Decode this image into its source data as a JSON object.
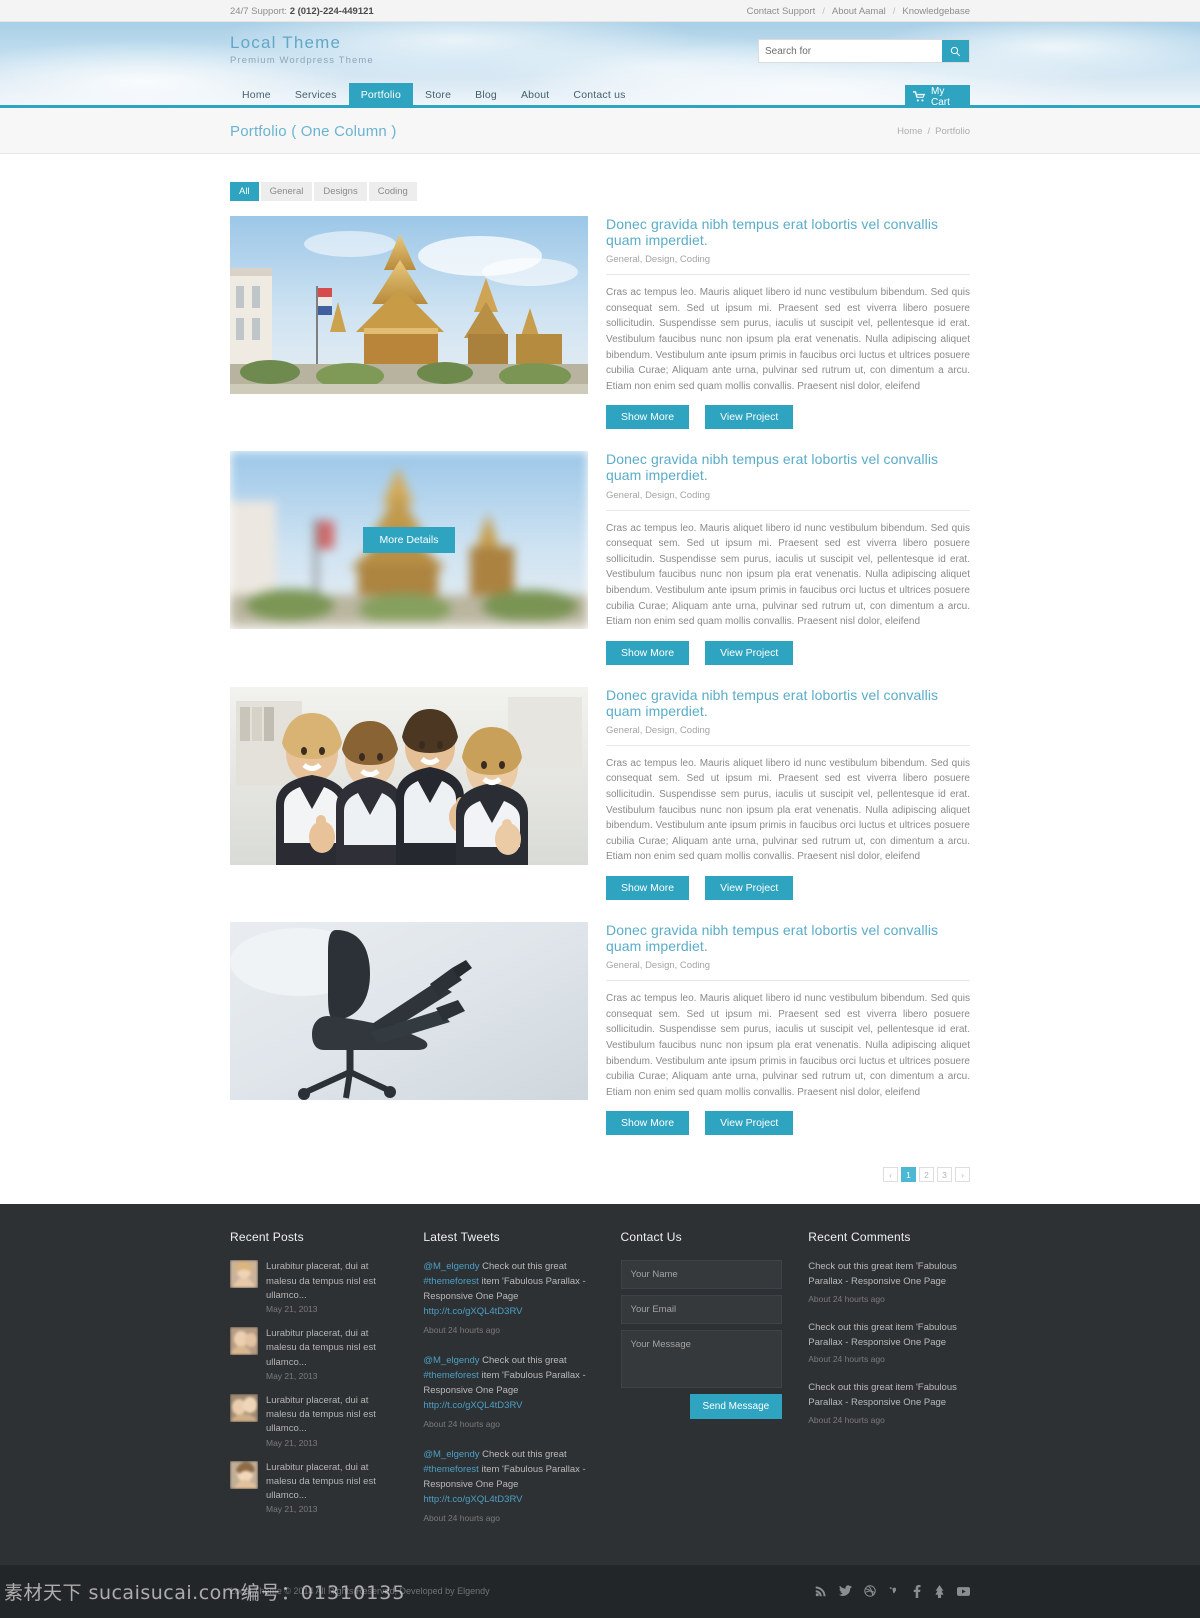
{
  "topbar": {
    "support_label": "24/7 Support:",
    "support_phone": "2 (012)-224-449121",
    "links": [
      "Contact Support",
      "About Aamal",
      "Knowledgebase"
    ],
    "separator": "/"
  },
  "header": {
    "brand_name": "Local Theme",
    "brand_tagline": "Premium Wordpress Theme",
    "search_placeholder": "Search for",
    "search_value": "",
    "search_icon": "search-icon",
    "cart_label": "My Cart",
    "cart_icon": "cart-icon",
    "nav": [
      {
        "label": "Home",
        "active": false
      },
      {
        "label": "Services",
        "active": false
      },
      {
        "label": "Portfolio",
        "active": true
      },
      {
        "label": "Store",
        "active": false
      },
      {
        "label": "Blog",
        "active": false
      },
      {
        "label": "About",
        "active": false
      },
      {
        "label": "Contact us",
        "active": false
      }
    ]
  },
  "pagehead": {
    "title": "Portfolio ( One Column )",
    "breadcrumb": [
      "Home",
      "Portfolio"
    ],
    "breadcrumb_separator": "/"
  },
  "filters": [
    {
      "label": "All",
      "active": true
    },
    {
      "label": "General",
      "active": false
    },
    {
      "label": "Designs",
      "active": false
    },
    {
      "label": "Coding",
      "active": false
    }
  ],
  "portfolio_items": [
    {
      "title": "Donec gravida nibh tempus erat lobortis vel convallis quam imperdiet.",
      "categories": "General, Design, Coding",
      "description": "Cras ac tempus leo. Mauris aliquet libero id nunc vestibulum bibendum. Sed quis consequat sem. Sed ut ipsum mi. Praesent sed est viverra libero posuere sollicitudin. Suspendisse sem purus, iaculis ut suscipit vel, pellentesque id erat. Vestibulum faucibus nunc non ipsum pla erat venenatis. Nulla adipiscing aliquet bibendum. Vestibulum ante ipsum primis in faucibus orci luctus et ultrices posuere cubilia Curae; Aliquam ante urna, pulvinar sed rutrum ut, con dimentum a arcu. Etiam non enim sed quam mollis convallis. Praesent nisl dolor, eleifend",
      "show_more_label": "Show More",
      "view_project_label": "View Project",
      "image": "temple-thailand",
      "hovered": false,
      "hover_label": "More Details"
    },
    {
      "title": "Donec gravida nibh tempus erat lobortis vel convallis quam imperdiet.",
      "categories": "General, Design, Coding",
      "description": "Cras ac tempus leo. Mauris aliquet libero id nunc vestibulum bibendum. Sed quis consequat sem. Sed ut ipsum mi. Praesent sed est viverra libero posuere sollicitudin. Suspendisse sem purus, iaculis ut suscipit vel, pellentesque id erat. Vestibulum faucibus nunc non ipsum pla erat venenatis. Nulla adipiscing aliquet bibendum. Vestibulum ante ipsum primis in faucibus orci luctus et ultrices posuere cubilia Curae; Aliquam ante urna, pulvinar sed rutrum ut, con dimentum a arcu. Etiam non enim sed quam mollis convallis. Praesent nisl dolor, eleifend",
      "show_more_label": "Show More",
      "view_project_label": "View Project",
      "image": "temple-blurred",
      "hovered": true,
      "hover_label": "More Details"
    },
    {
      "title": "Donec gravida nibh tempus erat lobortis vel convallis quam imperdiet.",
      "categories": "General, Design, Coding",
      "description": "Cras ac tempus leo. Mauris aliquet libero id nunc vestibulum bibendum. Sed quis consequat sem. Sed ut ipsum mi. Praesent sed est viverra libero posuere sollicitudin. Suspendisse sem purus, iaculis ut suscipit vel, pellentesque id erat. Vestibulum faucibus nunc non ipsum pla erat venenatis. Nulla adipiscing aliquet bibendum. Vestibulum ante ipsum primis in faucibus orci luctus et ultrices posuere cubilia Curae; Aliquam ante urna, pulvinar sed rutrum ut, con dimentum a arcu. Etiam non enim sed quam mollis convallis. Praesent nisl dolor, eleifend",
      "show_more_label": "Show More",
      "view_project_label": "View Project",
      "image": "business-team",
      "hovered": false,
      "hover_label": "More Details"
    },
    {
      "title": "Donec gravida nibh tempus erat lobortis vel convallis quam imperdiet.",
      "categories": "General, Design, Coding",
      "description": "Cras ac tempus leo. Mauris aliquet libero id nunc vestibulum bibendum. Sed quis consequat sem. Sed ut ipsum mi. Praesent sed est viverra libero posuere sollicitudin. Suspendisse sem purus, iaculis ut suscipit vel, pellentesque id erat. Vestibulum faucibus nunc non ipsum pla erat venenatis. Nulla adipiscing aliquet bibendum. Vestibulum ante ipsum primis in faucibus orci luctus et ultrices posuere cubilia Curae; Aliquam ante urna, pulvinar sed rutrum ut, con dimentum a arcu. Etiam non enim sed quam mollis convallis. Praesent nisl dolor, eleifend",
      "show_more_label": "Show More",
      "view_project_label": "View Project",
      "image": "office-chair-silhouette",
      "hovered": false,
      "hover_label": "More Details"
    }
  ],
  "pagination": {
    "prev": "‹",
    "next": "›",
    "pages": [
      "1",
      "2",
      "3"
    ],
    "current": "1"
  },
  "footer": {
    "recent_posts": {
      "heading": "Recent Posts",
      "items": [
        {
          "text": "Lurabitur placerat, dui at malesu da tempus nisl est ullamco...",
          "date": "May 21, 2013"
        },
        {
          "text": "Lurabitur placerat, dui at malesu da tempus nisl est ullamco...",
          "date": "May 21, 2013"
        },
        {
          "text": "Lurabitur placerat, dui at malesu da tempus nisl est ullamco...",
          "date": "May 21, 2013"
        },
        {
          "text": "Lurabitur placerat, dui at malesu da tempus nisl est ullamco...",
          "date": "May 21, 2013"
        }
      ]
    },
    "latest_tweets": {
      "heading": "Latest Tweets",
      "items": [
        {
          "handle": "@M_elgendy",
          "text": " Check out this great ",
          "hashtag": "#themeforest",
          "text2": " item 'Fabulous Parallax - Responsive One Page ",
          "link": "http://t.co/gXQL4tD3RV",
          "ago": "About 24 hourts ago"
        },
        {
          "handle": "@M_elgendy",
          "text": " Check out this great ",
          "hashtag": "#themeforest",
          "text2": " item 'Fabulous Parallax - Responsive One Page ",
          "link": "http://t.co/gXQL4tD3RV",
          "ago": "About 24 hourts ago"
        },
        {
          "handle": "@M_elgendy",
          "text": " Check out this great ",
          "hashtag": "#themeforest",
          "text2": " item 'Fabulous Parallax - Responsive One Page ",
          "link": "http://t.co/gXQL4tD3RV",
          "ago": "About 24 hourts ago"
        }
      ]
    },
    "contact": {
      "heading": "Contact Us",
      "name_placeholder": "Your Name",
      "name_value": "",
      "email_placeholder": "Your Email",
      "email_value": "",
      "message_placeholder": "Your Message",
      "message_value": "",
      "send_label": "Send Message"
    },
    "recent_comments": {
      "heading": "Recent Comments",
      "items": [
        {
          "text": "Check out this great item 'Fabulous Parallax - Responsive One Page",
          "ago": "About 24 hourts ago"
        },
        {
          "text": "Check out this great item 'Fabulous Parallax - Responsive One Page",
          "ago": "About 24 hourts ago"
        },
        {
          "text": "Check out this great item 'Fabulous Parallax - Responsive One Page",
          "ago": "About 24 hourts ago"
        }
      ]
    }
  },
  "bottombar": {
    "copyright": "Local Theme © 2014 All Rights Reserved, Developed by Elgendy",
    "social": [
      "rss-icon",
      "twitter-icon",
      "dribbble-icon",
      "vimeo-icon",
      "facebook-icon",
      "forrst-icon",
      "youtube-icon"
    ]
  },
  "watermark": {
    "text": "素材天下 sucaisucai.com",
    "number": " 编号：01310135"
  },
  "colors": {
    "accent": "#2fa4c0",
    "accent_light": "#4cb8d4",
    "heading_blue": "#5aacc9",
    "footer_bg": "#2e3134",
    "bottombar_bg": "#232628"
  }
}
